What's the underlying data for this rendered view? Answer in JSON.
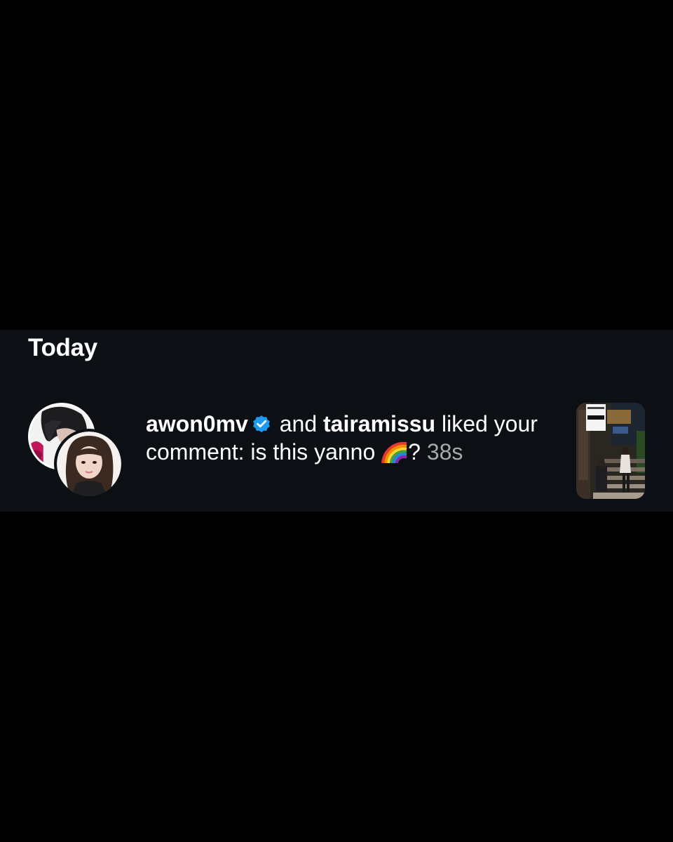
{
  "section": {
    "title": "Today"
  },
  "notification": {
    "user1": "awon0mv",
    "user1_verified": true,
    "connector": " and ",
    "user2": "tairamissu",
    "action": " liked your comment: is this yanno ",
    "comment_emoji": "rainbow-emoji",
    "comment_suffix": "? ",
    "time": "38s",
    "avatars": [
      "avatar-user1",
      "avatar-user2"
    ],
    "post_thumbnail": "post-thumbnail-image"
  },
  "colors": {
    "background": "#000000",
    "panel": "#0c1014",
    "text": "#ffffff",
    "secondary_text": "#a8a8a8",
    "verified_badge": "#1d9bf0"
  }
}
